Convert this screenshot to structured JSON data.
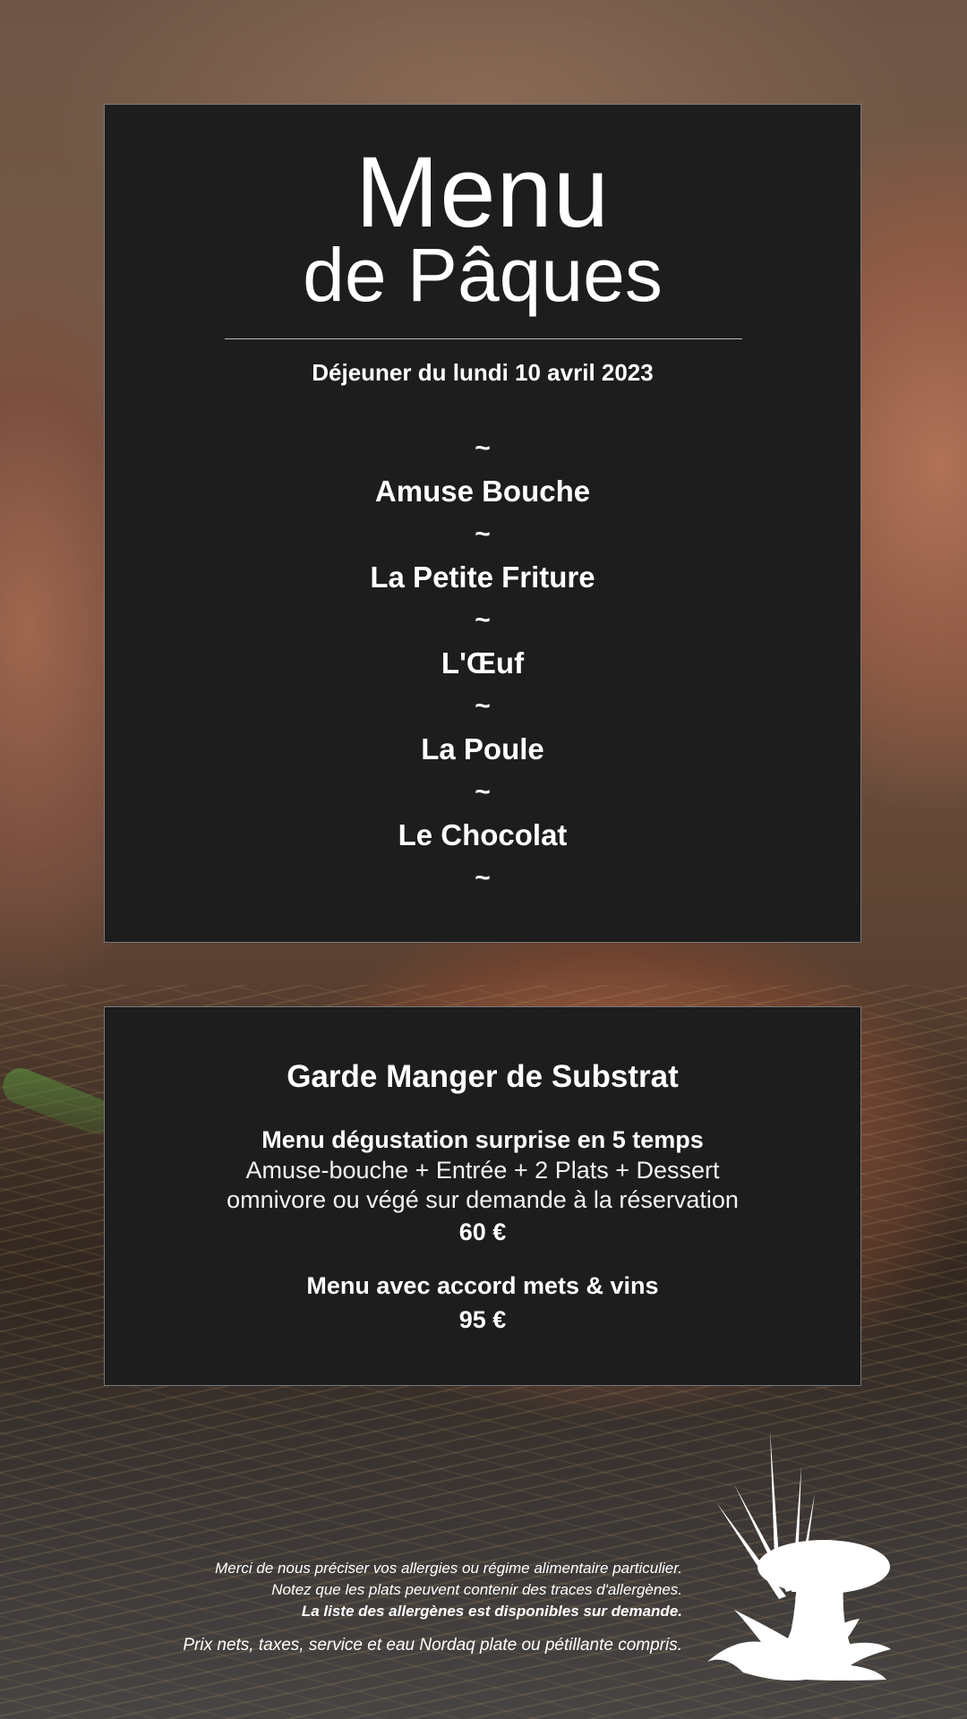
{
  "header": {
    "title": "Menu",
    "subtitle": "de Pâques",
    "date": "Déjeuner du lundi 10 avril 2023"
  },
  "separator": "~",
  "courses": [
    "Amuse Bouche",
    "La Petite Friture",
    "L'Œuf",
    "La Poule",
    "Le Chocolat"
  ],
  "pricing": {
    "title": "Garde Manger de Substrat",
    "tasting": {
      "heading": "Menu dégustation surprise en 5 temps",
      "detail1": "Amuse-bouche + Entrée + 2 Plats + Dessert",
      "detail2": "omnivore ou végé sur demande à la réservation",
      "price": "60 €"
    },
    "pairing": {
      "heading": "Menu avec accord mets & vins",
      "price": "95 €"
    }
  },
  "footer": {
    "note1": "Merci de nous préciser vos allergies ou régime alimentaire particulier.",
    "note2": "Notez que les plats peuvent contenir des traces d'allergènes.",
    "note3": "La liste des allergènes est disponibles sur demande.",
    "note4": "Prix nets, taxes, service et eau Nordaq plate ou pétillante compris."
  },
  "logo": {
    "icon": "mushroom-grass-icon",
    "color": "#ffffff"
  },
  "colors": {
    "card": "#1d1d1d",
    "text": "#ffffff"
  }
}
